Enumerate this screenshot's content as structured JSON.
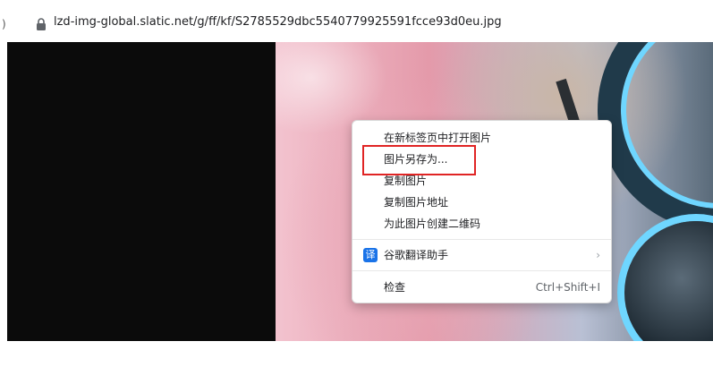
{
  "address_bar": {
    "back_glyph": ")",
    "url": "lzd-img-global.slatic.net/g/ff/kf/S2785529dbc5540779925591fcce93d0eu.jpg"
  },
  "context_menu": {
    "items": [
      {
        "label": "在新标签页中打开图片"
      },
      {
        "label": "图片另存为..."
      },
      {
        "label": "复制图片"
      },
      {
        "label": "复制图片地址"
      },
      {
        "label": "为此图片创建二维码"
      }
    ],
    "translate": {
      "icon_glyph": "译",
      "label": "谷歌翻译助手",
      "chevron": "›"
    },
    "inspect": {
      "label": "检查",
      "shortcut": "Ctrl+Shift+I"
    }
  },
  "colors": {
    "highlight": "#e02424",
    "translate_icon_bg": "#1a73e8"
  }
}
